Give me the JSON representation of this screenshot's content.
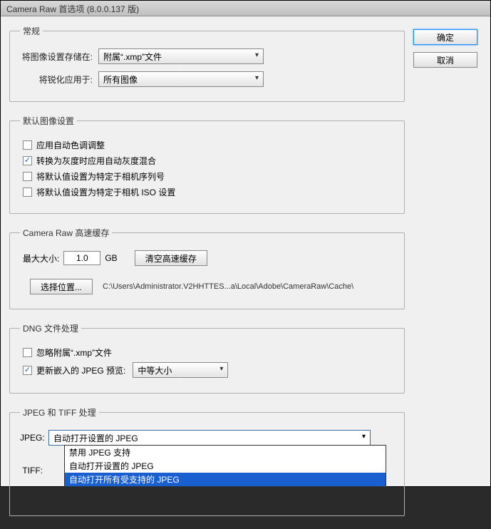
{
  "window": {
    "title": "Camera Raw 首选项  (8.0.0.137 版)"
  },
  "buttons": {
    "ok": "确定",
    "cancel": "取消"
  },
  "general": {
    "legend": "常规",
    "store_label": "将图像设置存储在:",
    "store_value": "附属“.xmp”文件",
    "sharpen_label": "将锐化应用于:",
    "sharpen_value": "所有图像"
  },
  "defaults": {
    "legend": "默认图像设置",
    "auto_tone": "应用自动色调调整",
    "grayscale_mix": "转换为灰度时应用自动灰度混合",
    "serial": "将默认值设置为特定于相机序列号",
    "iso": "将默认值设置为特定于相机 ISO 设置"
  },
  "cache": {
    "legend": "Camera Raw 高速缓存",
    "max_label": "最大大小:",
    "max_value": "1.0",
    "gb": "GB",
    "purge": "清空高速缓存",
    "select_loc": "选择位置...",
    "path": "C:\\Users\\Administrator.V2HHTTES...a\\Local\\Adobe\\CameraRaw\\Cache\\"
  },
  "dng": {
    "legend": "DNG 文件处理",
    "ignore_xmp": "忽略附属“.xmp”文件",
    "update_jpeg": "更新嵌入的 JPEG 预览:",
    "preview_value": "中等大小"
  },
  "jt": {
    "legend": "JPEG 和 TIFF 处理",
    "jpeg_label": "JPEG:",
    "tiff_label": "TIFF:",
    "jpeg_value": "自动打开设置的 JPEG",
    "options": [
      "禁用 JPEG 支持",
      "自动打开设置的 JPEG",
      "自动打开所有受支持的 JPEG"
    ]
  }
}
